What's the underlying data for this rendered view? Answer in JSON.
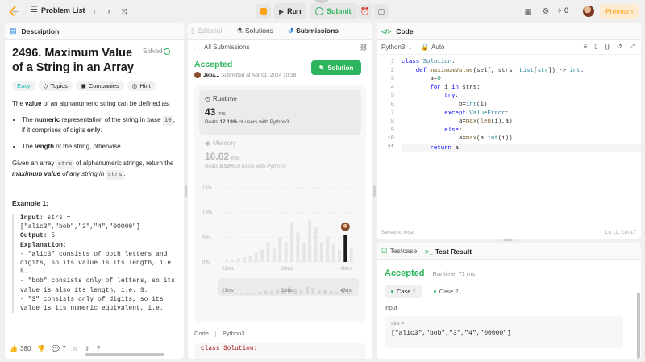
{
  "topbar": {
    "problem_list": "Problem List",
    "run": "Run",
    "submit": "Submit",
    "notification_count": "0",
    "premium": "Premium"
  },
  "description": {
    "tab_label": "Description",
    "title": "2496. Maximum Value of a String in an Array",
    "solved": "Solved",
    "tags": {
      "easy": "Easy",
      "topics": "Topics",
      "companies": "Companies",
      "hint": "Hint"
    },
    "intro": {
      "the": "The ",
      "value": "value",
      "rest": " of an alphanumeric string can be defined as:"
    },
    "bullet1": {
      "pre": "The ",
      "bold": "numeric",
      "mid": " representation of the string in base ",
      "code": "10",
      "post": ", if it comprises of digits ",
      "only": "only",
      "end": "."
    },
    "bullet2": {
      "pre": "The ",
      "bold": "length",
      "post": " of the string, otherwise."
    },
    "given": {
      "pre": "Given an array ",
      "code1": "strs",
      "mid": " of alphanumeric strings, return the ",
      "bold": "maximum value",
      "mid2": " of any string in ",
      "code2": "strs",
      "end": "."
    },
    "example_title": "Example 1:",
    "example": {
      "input_label": "Input:",
      "input_value": " strs = [\"alic3\",\"bob\",\"3\",\"4\",\"00000\"]",
      "output_label": "Output:",
      "output_value": " 5",
      "explanation_label": "Explanation:",
      "explanation_lines": [
        "- \"alic3\" consists of both letters and digits, so its value is its length, i.e. 5.",
        "- \"bob\" consists only of letters, so its value is also its length, i.e. 3.",
        "- \"3\" consists only of digits, so its value is its numeric equivalent, i.e."
      ]
    },
    "likes": "380",
    "comments": "7"
  },
  "submissions": {
    "tabs": {
      "editorial": "Editorial",
      "solutions": "Solutions",
      "submissions": "Submissions"
    },
    "all_submissions": "All Submissions",
    "status": "Accepted",
    "user": "Jeba...",
    "submitted_at": "submitted at Apr 01, 2024 10:38",
    "solution_button": "Solution",
    "runtime_label": "Runtime",
    "runtime_value": "43",
    "runtime_unit": "ms",
    "runtime_beats": {
      "pre": "Beats ",
      "pct": "17.19%",
      "post": " of users with Python3"
    },
    "memory_label": "Memory",
    "memory_value": "16.62",
    "memory_unit": "MB",
    "memory_beats": {
      "pre": "Beats ",
      "pct": "8.53%",
      "post": " of users with Python3"
    },
    "code_label": "Code",
    "code_lang": "Python3",
    "code_preview": "class Solution:"
  },
  "chart_data": {
    "type": "bar",
    "y_ticks": [
      "15%",
      "10%",
      "5%",
      "0%"
    ],
    "ylim": [
      0,
      15
    ],
    "x_ticks": [
      "23ms",
      "33ms",
      "43ms"
    ],
    "mini_x_ticks": [
      "23ms",
      "33ms",
      "43ms"
    ],
    "values": [
      0.4,
      0.6,
      0.8,
      1,
      1.2,
      1.8,
      2.5,
      4,
      3,
      5,
      4,
      8,
      6,
      4,
      8.5,
      7,
      4,
      5,
      3.5,
      2.5,
      5.5,
      3
    ],
    "highlight_index": 20,
    "bar_color": "#e6e6e6",
    "highlight_color": "#1a1a1a"
  },
  "code": {
    "tab_label": "Code",
    "language": "Python3",
    "mode": "Auto",
    "lines": [
      "class Solution:",
      "    def maximumValue(self, strs: List[str]) -> int:",
      "        a=0",
      "        for i in strs:",
      "            try:",
      "                b=int(i)",
      "            except ValueError:",
      "                a=max(len(i),a)",
      "            else:",
      "                a=max(a,int(i))",
      "        return a"
    ],
    "saved": "Saved to local",
    "cursor": "Ln 11, Col 17"
  },
  "result": {
    "testcase_tab": "Testcase",
    "result_tab": "Test Result",
    "status": "Accepted",
    "runtime": "Runtime: 71 ms",
    "case1": "Case 1",
    "case2": "Case 2",
    "input_label": "Input",
    "var_name": "strs =",
    "var_value": "[\"alic3\",\"bob\",\"3\",\"4\",\"00000\"]"
  },
  "colors": {
    "accent_green": "#2db55d",
    "accepted": "#2db55d",
    "premium": "#ffa116"
  }
}
